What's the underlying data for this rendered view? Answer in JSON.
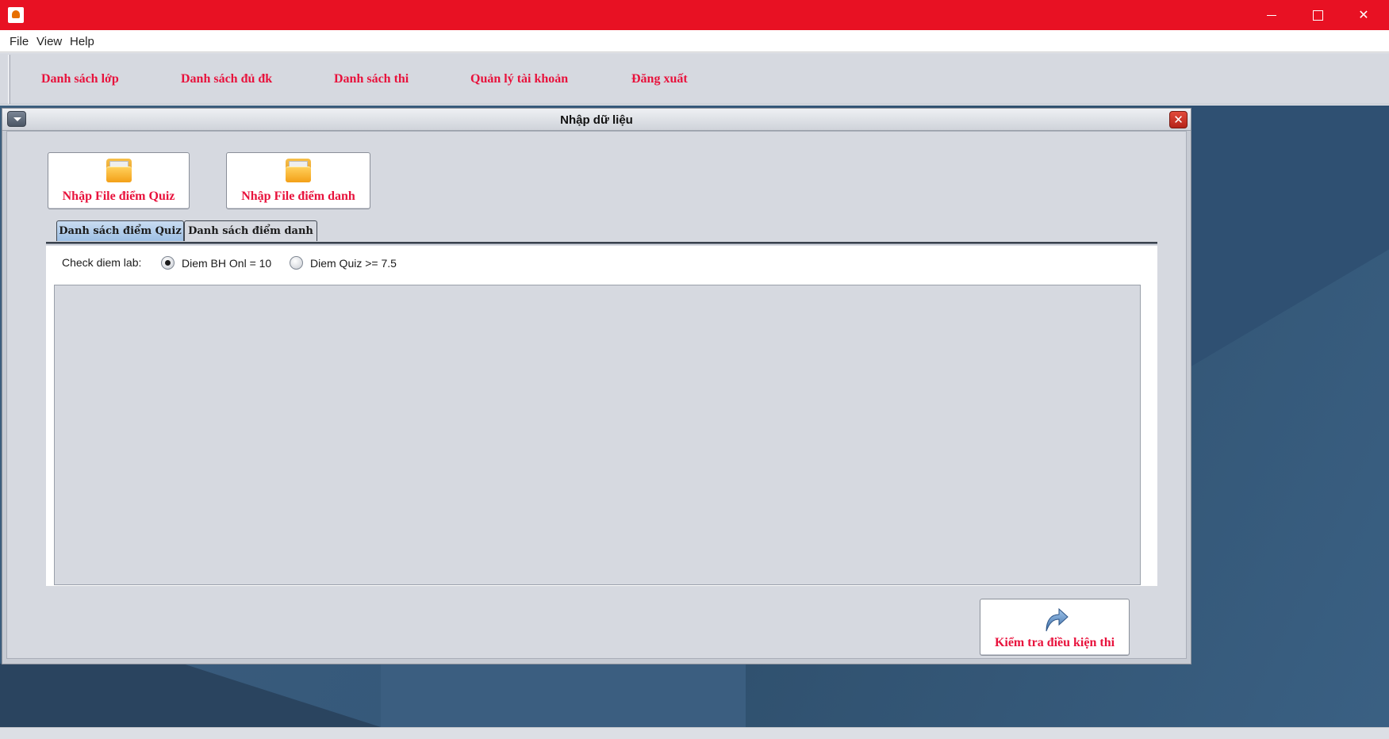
{
  "window": {
    "title": "",
    "controls": {
      "minimize": "—",
      "maximize": "☐",
      "close": "✕"
    }
  },
  "menubar": {
    "items": [
      "File",
      "View",
      "Help"
    ]
  },
  "nav": {
    "items": [
      "Danh sách lớp",
      "Danh sách đủ đk",
      "Danh sách thi",
      "Quản lý tài khoản",
      "Đăng xuất"
    ]
  },
  "dialog": {
    "title": "Nhập dữ liệu",
    "close_glyph": "✕",
    "buttons": {
      "import_quiz": "Nhập File điểm Quiz",
      "import_attendance": "Nhập File điểm danh",
      "check_conditions": "Kiểm tra điều kiện thi"
    },
    "tabs": [
      {
        "label": "Danh sách điểm Quiz",
        "active": true
      },
      {
        "label": "Danh sách điểm danh",
        "active": false
      }
    ],
    "check_label": "Check diem lab:",
    "radios": [
      {
        "label": "Diem BH Onl = 10",
        "checked": true
      },
      {
        "label": "Diem Quiz >= 7.5",
        "checked": false
      }
    ]
  },
  "icons": {
    "app": "java-icon",
    "import": "folder-icon",
    "check": "forward-arrow-icon"
  },
  "colors": {
    "titlebar": "#e81123",
    "accent_text": "#e8123c",
    "panel": "#d6d9e0",
    "desktop": "#35587a"
  }
}
